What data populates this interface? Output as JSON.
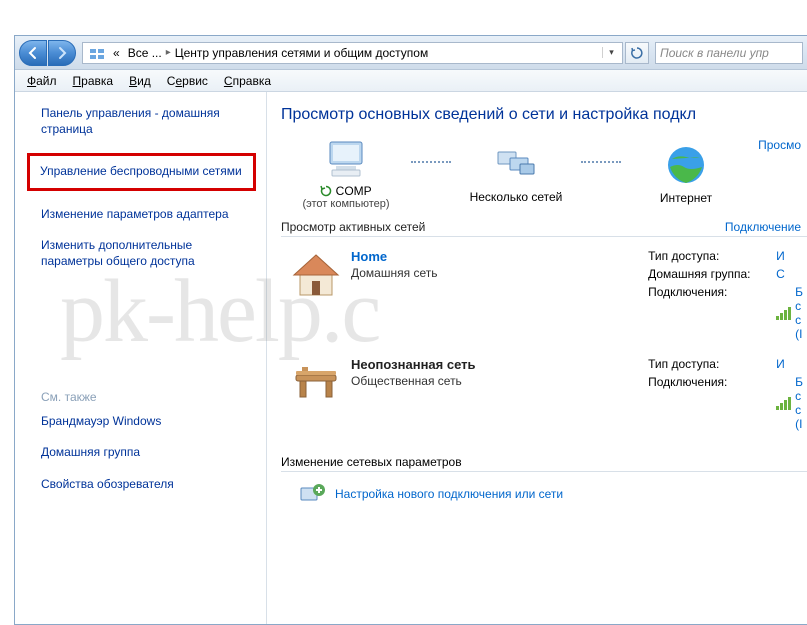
{
  "titlebar": {
    "history": "«",
    "crumb1": "Все ...",
    "crumb2": "Центр управления сетями и общим доступом",
    "search_placeholder": "Поиск в панели упр"
  },
  "menubar": {
    "file": "Файл",
    "edit": "Правка",
    "view": "Вид",
    "tools": "Сервис",
    "help": "Справка"
  },
  "sidebar": {
    "home": "Панель управления - домашняя страница",
    "wireless": "Управление беспроводными сетями",
    "adapter": "Изменение параметров адаптера",
    "sharing": "Изменить дополнительные параметры общего доступа",
    "see_also": "См. также",
    "firewall": "Брандмауэр Windows",
    "homegroup": "Домашняя группа",
    "ie": "Свойства обозревателя"
  },
  "main": {
    "title": "Просмотр основных сведений о сети и настройка подкл",
    "full_map": "Просмо",
    "node1_label": "COMP",
    "node1_sub": "(этот компьютер)",
    "node2_label": "Несколько сетей",
    "node3_label": "Интернет",
    "active_hdr": "Просмотр активных сетей",
    "active_hdr_r": "Подключение",
    "net1": {
      "name": "Home",
      "type": "Домашняя сеть",
      "k_access": "Тип доступа:",
      "v_access": "И",
      "k_hg": "Домашняя группа:",
      "v_hg": "С",
      "k_conn": "Подключения:",
      "v_conn": "Б\nс\nс\n(I"
    },
    "net2": {
      "name": "Неопознанная сеть",
      "type": "Общественная сеть",
      "k_access": "Тип доступа:",
      "v_access": "И",
      "k_conn": "Подключения:",
      "v_conn": "Б\nс\nс\n(I"
    },
    "change_hdr": "Изменение сетевых параметров",
    "task1": "Настройка нового подключения или сети"
  },
  "watermark": "pk-help.c"
}
